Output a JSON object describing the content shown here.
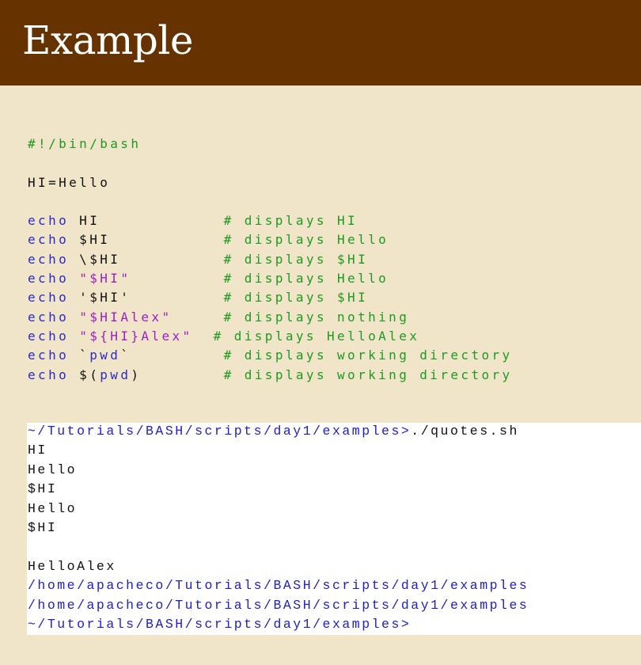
{
  "slide": {
    "title": "Example"
  },
  "colors": {
    "header": "#663300",
    "background": "#f0e5c9",
    "keyword": "#2a2ac8",
    "comment": "#1e9a1e",
    "string": "#a020c0",
    "prompt": "#2020c8"
  },
  "script_lines": [
    [
      {
        "t": "cm",
        "v": "#!/bin/bash"
      }
    ],
    [],
    [
      {
        "t": "pl",
        "v": "HI=Hello"
      }
    ],
    [],
    [
      {
        "t": "kw",
        "v": "echo"
      },
      {
        "t": "pl",
        "v": " HI            "
      },
      {
        "t": "cm",
        "v": "# displays HI"
      }
    ],
    [
      {
        "t": "kw",
        "v": "echo"
      },
      {
        "t": "pl",
        "v": " $HI           "
      },
      {
        "t": "cm",
        "v": "# displays Hello"
      }
    ],
    [
      {
        "t": "kw",
        "v": "echo"
      },
      {
        "t": "pl",
        "v": " \\$HI          "
      },
      {
        "t": "cm",
        "v": "# displays $HI"
      }
    ],
    [
      {
        "t": "kw",
        "v": "echo"
      },
      {
        "t": "pl",
        "v": " "
      },
      {
        "t": "st",
        "v": "\"$HI\""
      },
      {
        "t": "pl",
        "v": "         "
      },
      {
        "t": "cm",
        "v": "# displays Hello"
      }
    ],
    [
      {
        "t": "kw",
        "v": "echo"
      },
      {
        "t": "pl",
        "v": " '$HI'         "
      },
      {
        "t": "cm",
        "v": "# displays $HI"
      }
    ],
    [
      {
        "t": "kw",
        "v": "echo"
      },
      {
        "t": "pl",
        "v": " "
      },
      {
        "t": "st",
        "v": "\"$HIAlex\""
      },
      {
        "t": "pl",
        "v": "     "
      },
      {
        "t": "cm",
        "v": "# displays nothing"
      }
    ],
    [
      {
        "t": "kw",
        "v": "echo"
      },
      {
        "t": "pl",
        "v": " "
      },
      {
        "t": "st",
        "v": "\"${HI}Alex\""
      },
      {
        "t": "pl",
        "v": "  "
      },
      {
        "t": "cm",
        "v": "# displays HelloAlex"
      }
    ],
    [
      {
        "t": "kw",
        "v": "echo"
      },
      {
        "t": "pl",
        "v": " `"
      },
      {
        "t": "kw",
        "v": "pwd"
      },
      {
        "t": "pl",
        "v": "`         "
      },
      {
        "t": "cm",
        "v": "# displays working directory"
      }
    ],
    [
      {
        "t": "kw",
        "v": "echo"
      },
      {
        "t": "pl",
        "v": " $("
      },
      {
        "t": "kw",
        "v": "pwd"
      },
      {
        "t": "pl",
        "v": ")        "
      },
      {
        "t": "cm",
        "v": "# displays working directory"
      }
    ]
  ],
  "terminal_lines": [
    [
      {
        "t": "prompt",
        "v": "~/Tutorials/BASH/scripts/day1/examples>"
      },
      {
        "t": "txt",
        "v": "./quotes.sh"
      }
    ],
    [
      {
        "t": "txt",
        "v": "HI"
      }
    ],
    [
      {
        "t": "txt",
        "v": "Hello"
      }
    ],
    [
      {
        "t": "txt",
        "v": "$HI"
      }
    ],
    [
      {
        "t": "txt",
        "v": "Hello"
      }
    ],
    [
      {
        "t": "txt",
        "v": "$HI"
      }
    ],
    [],
    [
      {
        "t": "txt",
        "v": "HelloAlex"
      }
    ],
    [
      {
        "t": "prompt",
        "v": "/home/apacheco/Tutorials/BASH/scripts/day1/examples"
      }
    ],
    [
      {
        "t": "prompt",
        "v": "/home/apacheco/Tutorials/BASH/scripts/day1/examples"
      }
    ],
    [
      {
        "t": "prompt",
        "v": "~/Tutorials/BASH/scripts/day1/examples>"
      }
    ]
  ]
}
